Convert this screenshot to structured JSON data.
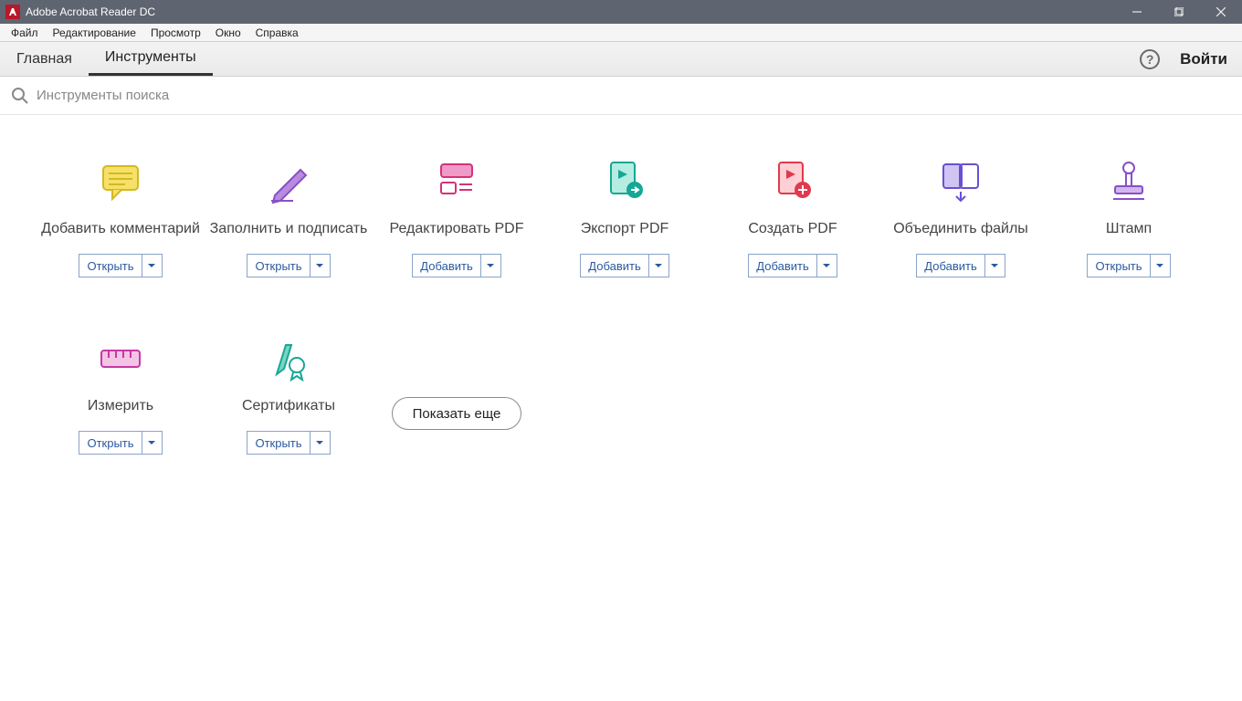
{
  "titlebar": {
    "title": "Adobe Acrobat Reader DC"
  },
  "menubar": {
    "items": [
      "Файл",
      "Редактирование",
      "Просмотр",
      "Окно",
      "Справка"
    ]
  },
  "toolbar": {
    "tabs": {
      "home": "Главная",
      "tools": "Инструменты"
    },
    "help_glyph": "?",
    "signin": "Войти"
  },
  "search": {
    "placeholder": "Инструменты поиска"
  },
  "buttons": {
    "open": "Открыть",
    "add": "Добавить",
    "show_more": "Показать еще"
  },
  "tools_row1": [
    {
      "label": "Добавить комментарий",
      "action": "open"
    },
    {
      "label": "Заполнить и подписать",
      "action": "open"
    },
    {
      "label": "Редактировать PDF",
      "action": "add"
    },
    {
      "label": "Экспорт PDF",
      "action": "add"
    },
    {
      "label": "Создать PDF",
      "action": "add"
    },
    {
      "label": "Объединить файлы",
      "action": "add"
    },
    {
      "label": "Штамп",
      "action": "open"
    }
  ],
  "tools_row2": [
    {
      "label": "Измерить",
      "action": "open"
    },
    {
      "label": "Сертификаты",
      "action": "open"
    }
  ]
}
